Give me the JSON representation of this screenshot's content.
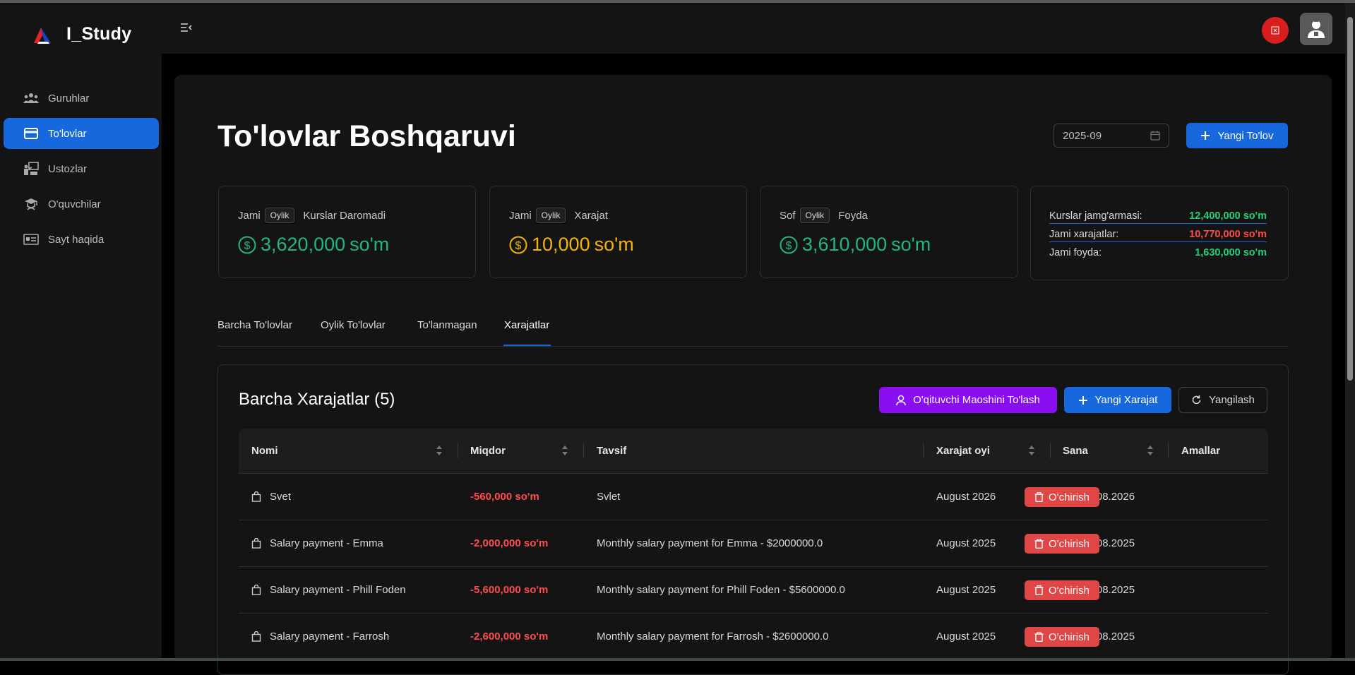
{
  "app": {
    "name": "I_Study"
  },
  "sidebar": {
    "items": [
      {
        "label": "Guruhlar",
        "icon": "users-icon",
        "active": false
      },
      {
        "label": "To'lovlar",
        "icon": "credit-card-icon",
        "active": true
      },
      {
        "label": "Ustozlar",
        "icon": "teacher-icon",
        "active": false
      },
      {
        "label": "O'quvchilar",
        "icon": "graduation-cap-icon",
        "active": false
      },
      {
        "label": "Sayt haqida",
        "icon": "id-card-icon",
        "active": false
      }
    ]
  },
  "page": {
    "title": "To'lovlar Boshqaruvi",
    "month": "2025-09",
    "new_payment_label": "Yangi To'lov"
  },
  "stats": [
    {
      "prefix": "Jami",
      "tag": "Oylik",
      "suffix": "Kurslar Daromadi",
      "value": "3,620,000",
      "unit": "so'm",
      "color": "#1fb77e"
    },
    {
      "prefix": "Jami",
      "tag": "Oylik",
      "suffix": "Xarajat",
      "value": "10,000",
      "unit": "so'm",
      "color": "#f5b400"
    },
    {
      "prefix": "Sof",
      "tag": "Oylik",
      "suffix": "Foyda",
      "value": "3,610,000",
      "unit": "so'm",
      "color": "#1fb77e"
    }
  ],
  "summary": [
    {
      "label": "Kurslar jamg'armasi:",
      "value": "12,400,000 so'm",
      "color": "#20d27a"
    },
    {
      "label": "Jami xarajatlar:",
      "value": "10,770,000 so'm",
      "color": "#ff4d4f"
    },
    {
      "label": "Jami foyda:",
      "value": "1,630,000 so'm",
      "color": "#20d27a"
    }
  ],
  "tabs": [
    "Barcha To'lovlar",
    "Oylik To'lovlar",
    "To'lanmagan",
    "Xarajatlar"
  ],
  "active_tab": "Xarajatlar",
  "expenses": {
    "title": "Barcha Xarajatlar (5)",
    "pay_salary_label": "O'qituvchi Maoshini To'lash",
    "new_expense_label": "Yangi Xarajat",
    "refresh_label": "Yangilash",
    "columns": [
      "Nomi",
      "Miqdor",
      "Tavsif",
      "Xarajat oyi",
      "Sana",
      "Amallar"
    ],
    "delete_label": "O'chirish",
    "rows": [
      {
        "name": "Svet",
        "amount": "-560,000 so'm",
        "description": "Svlet",
        "month": "August 2026",
        "date": "19.08.2026"
      },
      {
        "name": "Salary payment - Emma",
        "amount": "-2,000,000 so'm",
        "description": "Monthly salary payment for Emma - $2000000.0",
        "month": "August 2025",
        "date": "31.08.2025"
      },
      {
        "name": "Salary payment - Phill Foden",
        "amount": "-5,600,000 so'm",
        "description": "Monthly salary payment for Phill Foden - $5600000.0",
        "month": "August 2025",
        "date": "31.08.2025"
      },
      {
        "name": "Salary payment - Farrosh",
        "amount": "-2,600,000 so'm",
        "description": "Monthly salary payment for Farrosh - $2600000.0",
        "month": "August 2025",
        "date": "31.08.2025"
      }
    ]
  },
  "colors": {
    "accent": "#1668dc",
    "purple": "#8a0ff0",
    "danger": "#e04646"
  }
}
